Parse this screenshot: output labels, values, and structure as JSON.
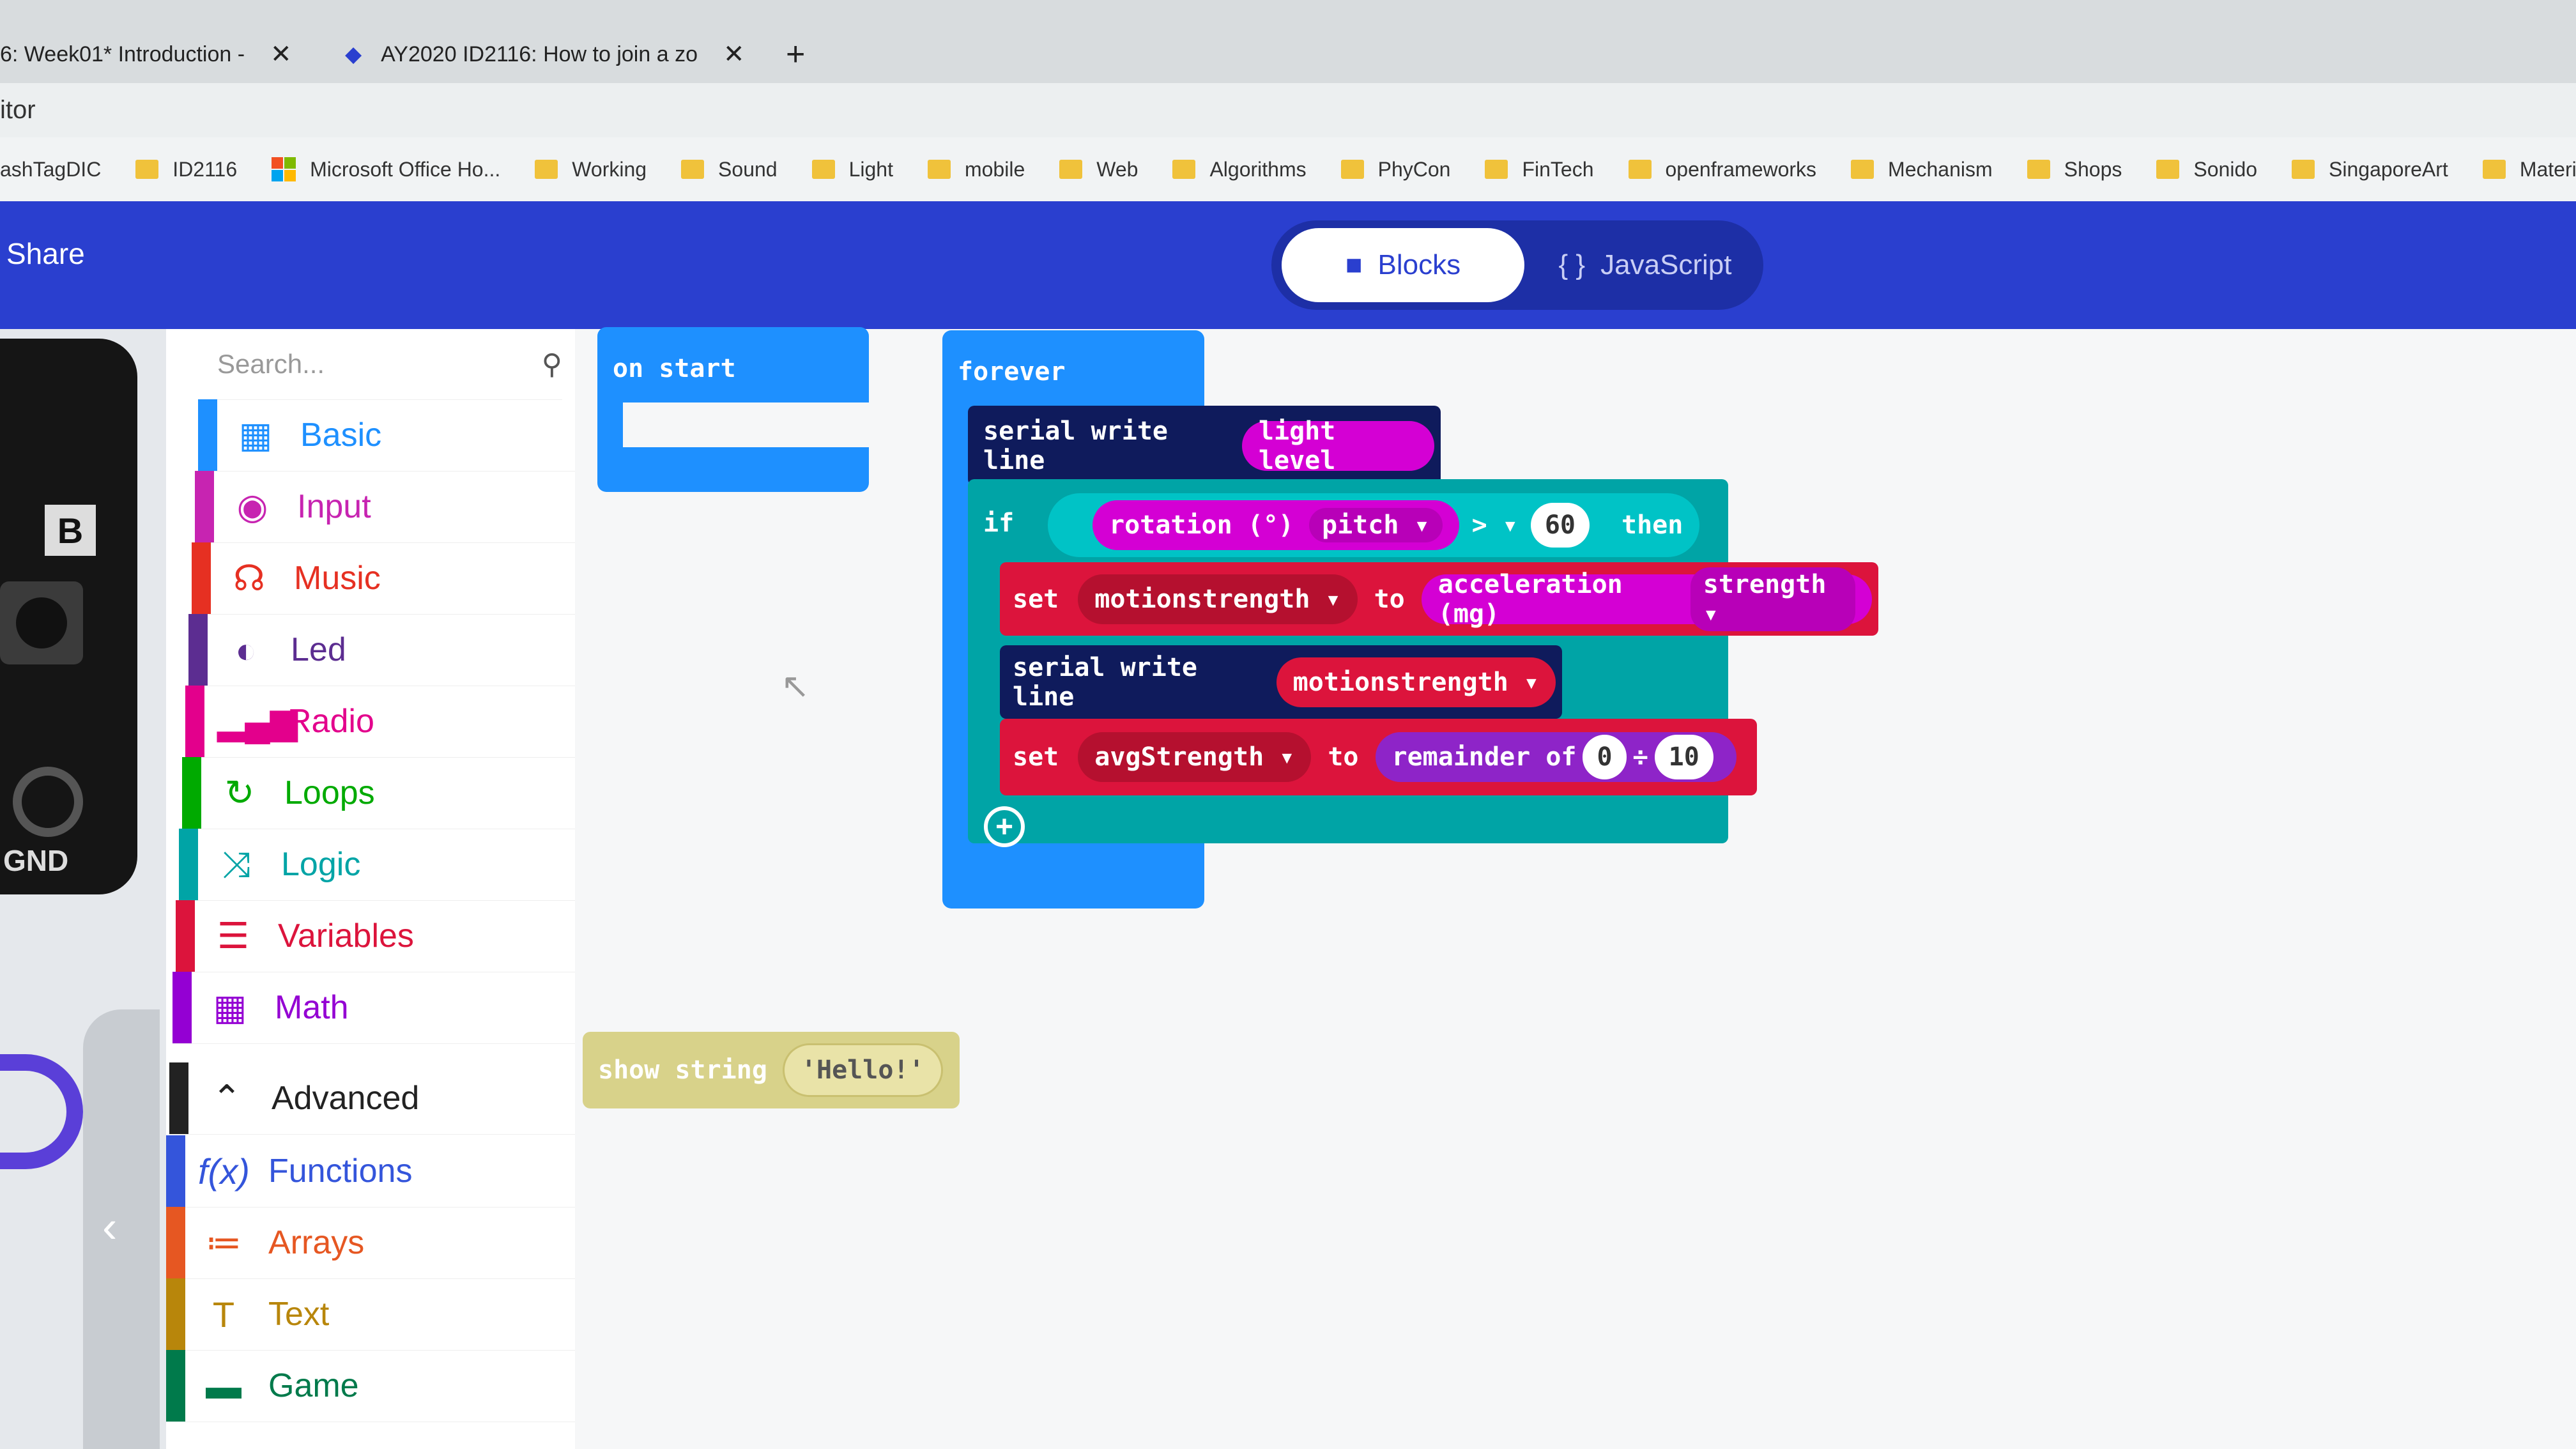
{
  "browser": {
    "tabs": [
      {
        "title": "6: Week01* Introduction - ",
        "close": "✕"
      },
      {
        "title": "AY2020 ID2116: How to join a zo",
        "close": "✕"
      }
    ],
    "new_tab": "+",
    "address_fragment": "itor",
    "bookmarks": [
      "ashTagDIC",
      "ID2116",
      "Microsoft Office Ho...",
      "Working",
      "Sound",
      "Light",
      "mobile",
      "Web",
      "Algorithms",
      "PhyCon",
      "FinTech",
      "openframeworks",
      "Mechanism",
      "Shops",
      "Sonido",
      "SingaporeArt",
      "Material"
    ]
  },
  "header": {
    "share_label": "Share",
    "blocks_label": "Blocks",
    "javascript_label": "JavaScript",
    "accent": "#2a3fcf"
  },
  "simulator": {
    "label_b": "B",
    "label_gnd": "GND"
  },
  "toolbox": {
    "search_placeholder": "Search...",
    "categories": [
      {
        "label": "Basic",
        "color": "#1e90ff",
        "icon": "grid-icon"
      },
      {
        "label": "Input",
        "color": "#c724b1",
        "icon": "target-icon"
      },
      {
        "label": "Music",
        "color": "#e63022",
        "icon": "headphones-icon"
      },
      {
        "label": "Led",
        "color": "#5c2d91",
        "icon": "toggle-icon"
      },
      {
        "label": "Radio",
        "color": "#e3008c",
        "icon": "signal-icon"
      },
      {
        "label": "Loops",
        "color": "#00aa00",
        "icon": "refresh-icon"
      },
      {
        "label": "Logic",
        "color": "#00a4a6",
        "icon": "shuffle-icon"
      },
      {
        "label": "Variables",
        "color": "#dc143c",
        "icon": "list-icon"
      },
      {
        "label": "Math",
        "color": "#9400d3",
        "icon": "calculator-icon"
      }
    ],
    "advanced_label": "Advanced",
    "advanced_categories": [
      {
        "label": "Functions",
        "color": "#3455db",
        "icon": "function-icon"
      },
      {
        "label": "Arrays",
        "color": "#e65722",
        "icon": "array-icon"
      },
      {
        "label": "Text",
        "color": "#b8860b",
        "icon": "text-icon"
      },
      {
        "label": "Game",
        "color": "#007a4b",
        "icon": "game-icon"
      }
    ]
  },
  "blocks": {
    "on_start": "on start",
    "forever": "forever",
    "serial_write_line_1": "serial write line",
    "light_level": "light level",
    "if": "if",
    "rotation": "rotation (°)",
    "pitch": "pitch",
    "compare_op": ">",
    "compare_value": "60",
    "then": "then",
    "set_1": "set",
    "var_motion": "motionstrength",
    "to_1": "to",
    "acceleration": "acceleration (mg)",
    "strength": "strength",
    "serial_write_line_2": "serial write line",
    "var_motion_2": "motionstrength",
    "set_2": "set",
    "var_avg": "avgStrength",
    "to_2": "to",
    "remainder_of": "remainder of",
    "rem_a": "0",
    "divide": "÷",
    "rem_b": "10",
    "show_string": "show string",
    "hello": "Hello!"
  }
}
